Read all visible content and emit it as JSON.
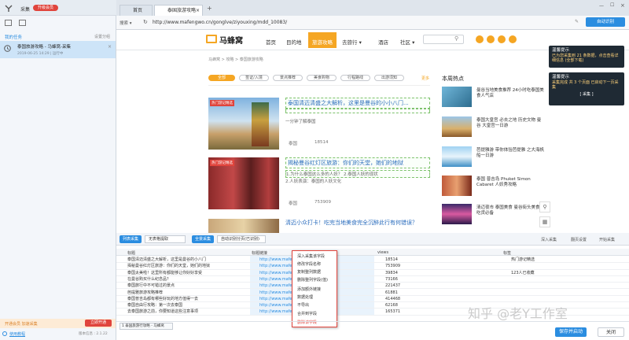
{
  "app": {
    "brand": "采集",
    "vip_badge": "升级会员"
  },
  "left": {
    "section_title": "我的任务",
    "section_action": "设置分组",
    "task_title": "泰国旅游攻略 - 马蜂窝-采集",
    "task_time": "2019-06-25 14:29 | 运行中",
    "upgrade_text": "开通会员 加速采集",
    "upgrade_btn": "立即开通",
    "footer_link": "使用教程",
    "footer_version": "版本信息 : 2.1.22"
  },
  "browser": {
    "tab_home": "首页",
    "tab_active": "泰国旅游攻略",
    "back_label": "搜索 ▾",
    "url": "http://www.mafengwo.cn/gonglve/ziyouxing/mdd_10083/",
    "ai_button": "自动识别"
  },
  "site": {
    "logo": "马蜂窝",
    "nav": [
      "首页",
      "目的地",
      "旅游攻略",
      "去旅行 ▾",
      "酒店",
      "社区 ▾"
    ],
    "breadcrumb": "马蜂窝 > 攻略 > 泰国旅游攻略",
    "filters": [
      "全部",
      "签证/入境",
      "景点推荐",
      "美食购物",
      "行程路线",
      "出游须知"
    ],
    "more": "更多",
    "side_title": "本周热点",
    "articles": [
      {
        "title": "泰国清迈清盛之大解析，这里是曼谷的小小八门...",
        "sub": "一分钟了解泰国",
        "tag": "热门游记精选",
        "place": "泰国",
        "views": "18514"
      },
      {
        "title": "揭秘曼谷红灯区旅游：你们的天堂，她们的地狱",
        "sub": "1.为什么泰国这么多的人妖？  2.泰国人妖的现状",
        "sub2": "2.人妖表演：泰国的人妖文化",
        "tag": "热门游记精选",
        "place": "泰国",
        "views": "753909"
      },
      {
        "title": "清迈小众打卡！吃完当地美食完全沉醉此行有何错误？",
        "sub": "",
        "tag": "",
        "place": "",
        "views": ""
      }
    ],
    "hot": [
      "曼谷当地美食推荐 24小时吃泰国美食人气店",
      "泰国大皇宫 必去之地 历史文物 曼谷 大皇宫一日游",
      "芭提雅游 带你体验芭提雅 之大海帆船一日游",
      "泰国 普吉岛 Phuket Simon Cabaret 人妖秀攻略",
      "清迈夜市 泰国美食 曼谷街头美食 吃货必备"
    ],
    "notifs": [
      {
        "title": "温馨提示",
        "body": "已为您采集到 21 条数据，点击查看详细信息 (全部下载)"
      },
      {
        "title": "温馨提示",
        "body": "采集完成 共 3 个页面 已启动下一页采集",
        "action": "[ 采集 ]"
      }
    ]
  },
  "bottom": {
    "tool_a": "列表采集",
    "tool_a_select": "无表格提取",
    "tool_b": "全景采集",
    "tool_b_select": "自动识别分页(已识别)",
    "tool_right": [
      "深入采集",
      "翻页设置",
      "开始采集"
    ],
    "cols": [
      "标题",
      "标题链接",
      "views",
      "标签"
    ],
    "rows": [
      [
        "泰国清迈清盛之大解析，这里是曼谷的小八门",
        "http://www.mafengwo...",
        "18514",
        "热门游记精选"
      ],
      [
        "揭秘曼谷红灯区旅游：你们的天堂，她们的地狱",
        "http://www.mafengwo...",
        "753909",
        ""
      ],
      [
        "泰国太美啦！这里所有都能够让你好好享受",
        "http://www.mafengwo...",
        "39834",
        "123人已收藏"
      ],
      [
        "在曼谷购买什么纪念品？",
        "http://www.mafengwo...",
        "73166",
        ""
      ],
      [
        "泰国旅行中不可错过的景点",
        "http://www.mafengwo...",
        "221437",
        ""
      ],
      [
        "芭提雅旅游攻略推荐",
        "http://www.mafengwo...",
        "61881",
        ""
      ],
      [
        "泰国普吉岛都有哪些好玩的地方值得一去",
        "http://www.mafengwo...",
        "414468",
        ""
      ],
      [
        "泰国自由行攻略：第一次去泰国",
        "http://www.mafengwo...",
        "62168",
        ""
      ],
      [
        "去泰国旅游之前，你要知道这些注意事项",
        "http://www.mafengwo...",
        "165371",
        ""
      ]
    ],
    "status_text": "1 泰国旅游行攻略 - 马蜂窝",
    "ctx_menu": [
      "深入采集该字段",
      "修改字段名称",
      "复制整列数据",
      "删除整列字段(值)",
      "添加额外链接",
      "数据处理",
      "不导出",
      "合并到字段",
      "删除该字段"
    ],
    "save_btn": "保存并启动",
    "close_btn": "关闭",
    "watermark": "知乎 @老Y工作室"
  },
  "colors": {
    "accent": "#2b8de0",
    "orange": "#f5a623",
    "danger": "#e0443c"
  }
}
